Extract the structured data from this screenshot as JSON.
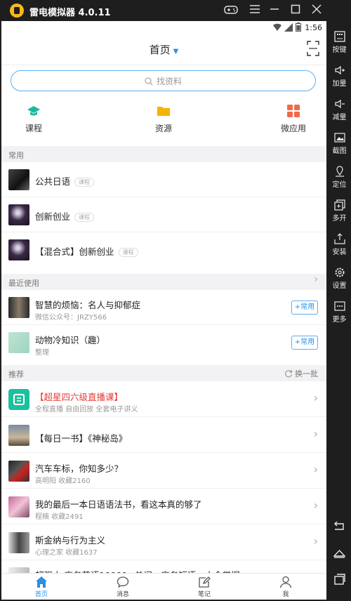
{
  "window": {
    "title": "雷电模拟器 4.0.11"
  },
  "statusbar": {
    "time": "1:56"
  },
  "header": {
    "title": "首页"
  },
  "search": {
    "placeholder": "找资料"
  },
  "categories": [
    {
      "label": "课程",
      "icon": "graduation-cap-icon",
      "color": "#1cb8a0"
    },
    {
      "label": "资源",
      "icon": "folder-icon",
      "color": "#f5b400"
    },
    {
      "label": "微应用",
      "icon": "grid-icon",
      "color": "#f06a4a"
    }
  ],
  "sections": {
    "common": "常用",
    "recent": "最近使用",
    "recommend": "推荐",
    "refresh": "换一批"
  },
  "common_items": [
    {
      "title": "公共日语",
      "tag": "课程"
    },
    {
      "title": "创新创业",
      "tag": "课程"
    },
    {
      "title": "【混合式】创新创业",
      "tag": "课程"
    }
  ],
  "recent_items": [
    {
      "title": "智慧的烦恼：名人与抑郁症",
      "sub": "微信公众号：JRZY566",
      "button": "+常用"
    },
    {
      "title": "动物冷知识（趣）",
      "sub": "整理",
      "button": "+常用"
    }
  ],
  "recommend_items": [
    {
      "title": "【超星四六级直播课】",
      "sub": "全程直播  自由回放  全套电子讲义",
      "highlight": true
    },
    {
      "title": "【每日一书】《神秘岛》",
      "sub": ""
    },
    {
      "title": "汽车车标，你知多少？",
      "sub": "高明阳  收藏2160"
    },
    {
      "title": "我的最后一本日语语法书，看这本真的够了",
      "sub": "程楠  收藏2491"
    },
    {
      "title": "斯金纳与行为主义",
      "sub": "心理之家  收藏1637"
    },
    {
      "title": "超强大 商务英语10000+单词、商务短语、大全掌握",
      "sub": ""
    }
  ],
  "tabs": [
    {
      "label": "首页",
      "active": true
    },
    {
      "label": "消息"
    },
    {
      "label": "笔记"
    },
    {
      "label": "我"
    }
  ],
  "sidebar": [
    {
      "label": "按键",
      "icon": "keyboard-icon"
    },
    {
      "label": "加量",
      "icon": "volume-up-icon"
    },
    {
      "label": "减量",
      "icon": "volume-down-icon"
    },
    {
      "label": "截图",
      "icon": "screenshot-icon"
    },
    {
      "label": "定位",
      "icon": "location-icon"
    },
    {
      "label": "多开",
      "icon": "multi-open-icon"
    },
    {
      "label": "安装",
      "icon": "install-icon"
    },
    {
      "label": "设置",
      "icon": "gear-icon"
    },
    {
      "label": "更多",
      "icon": "more-icon"
    }
  ]
}
